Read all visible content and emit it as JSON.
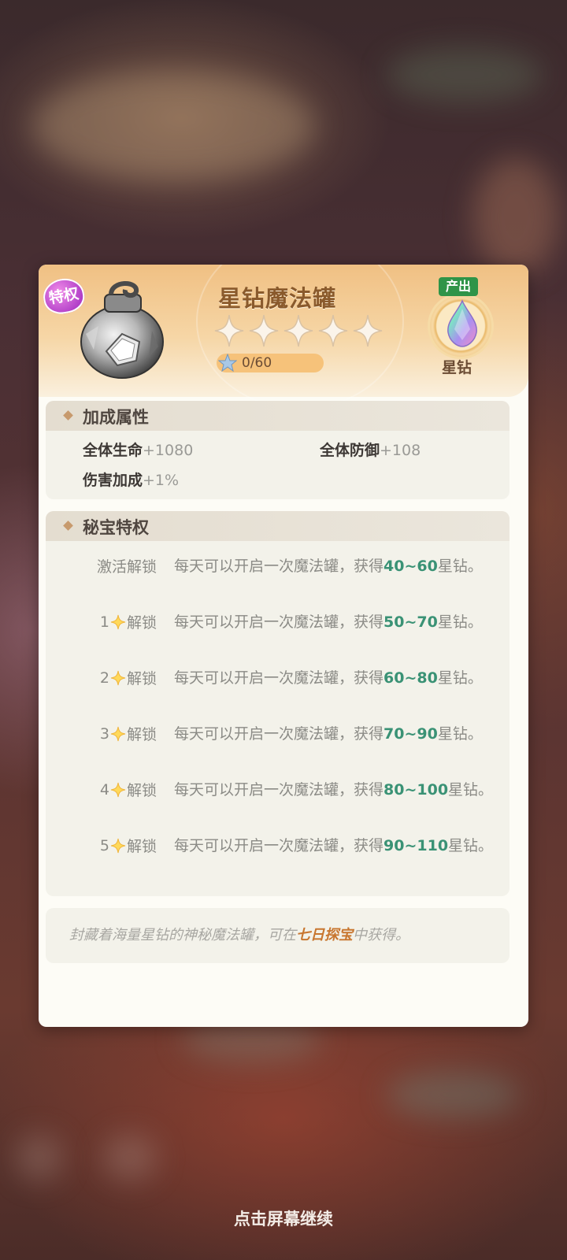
{
  "item": {
    "badge": "特权",
    "name": "星钻魔法罐",
    "star_count": 5,
    "stars_filled": 0,
    "progress_text": "0/60",
    "output_tag": "产出",
    "output_name": "星钻"
  },
  "bonus": {
    "title": "加成属性",
    "attrs": [
      {
        "name": "全体生命",
        "value": "+1080"
      },
      {
        "name": "全体防御",
        "value": "+108"
      },
      {
        "name": "伤害加成",
        "value": "+1%"
      }
    ]
  },
  "privilege": {
    "title": "秘宝特权",
    "rows": [
      {
        "level": "",
        "unlock": "激活解锁",
        "desc_pre": "每天可以开启一次魔法罐，获得",
        "range": "40~60",
        "desc_post": "星钻。"
      },
      {
        "level": "1",
        "unlock": "解锁",
        "desc_pre": "每天可以开启一次魔法罐，获得",
        "range": "50~70",
        "desc_post": "星钻。"
      },
      {
        "level": "2",
        "unlock": "解锁",
        "desc_pre": "每天可以开启一次魔法罐，获得",
        "range": "60~80",
        "desc_post": "星钻。"
      },
      {
        "level": "3",
        "unlock": "解锁",
        "desc_pre": "每天可以开启一次魔法罐，获得",
        "range": "70~90",
        "desc_post": "星钻。"
      },
      {
        "level": "4",
        "unlock": "解锁",
        "desc_pre": "每天可以开启一次魔法罐，获得",
        "range": "80~100",
        "desc_post": "星钻。"
      },
      {
        "level": "5",
        "unlock": "解锁",
        "desc_pre": "每天可以开启一次魔法罐，获得",
        "range": "90~110",
        "desc_post": "星钻。"
      }
    ]
  },
  "flavor": {
    "pre": "封藏着海量星钻的神秘魔法罐，可在",
    "highlight": "七日探宝",
    "post": "中获得。"
  },
  "footer": {
    "continue_text": "点击屏幕继续"
  },
  "colors": {
    "highlight_green": "#3a9275",
    "highlight_orange": "#c8762f",
    "title_brown": "#8a5a2c",
    "output_tag_green": "#2f9448"
  },
  "icons": {
    "badge": "privilege-badge-icon",
    "item": "magic-jar-icon",
    "star": "star-empty-icon",
    "progress": "star-shard-icon",
    "output": "star-diamond-gem-icon",
    "spark": "sparkle-star-icon",
    "section": "diamond-bullet-icon"
  }
}
